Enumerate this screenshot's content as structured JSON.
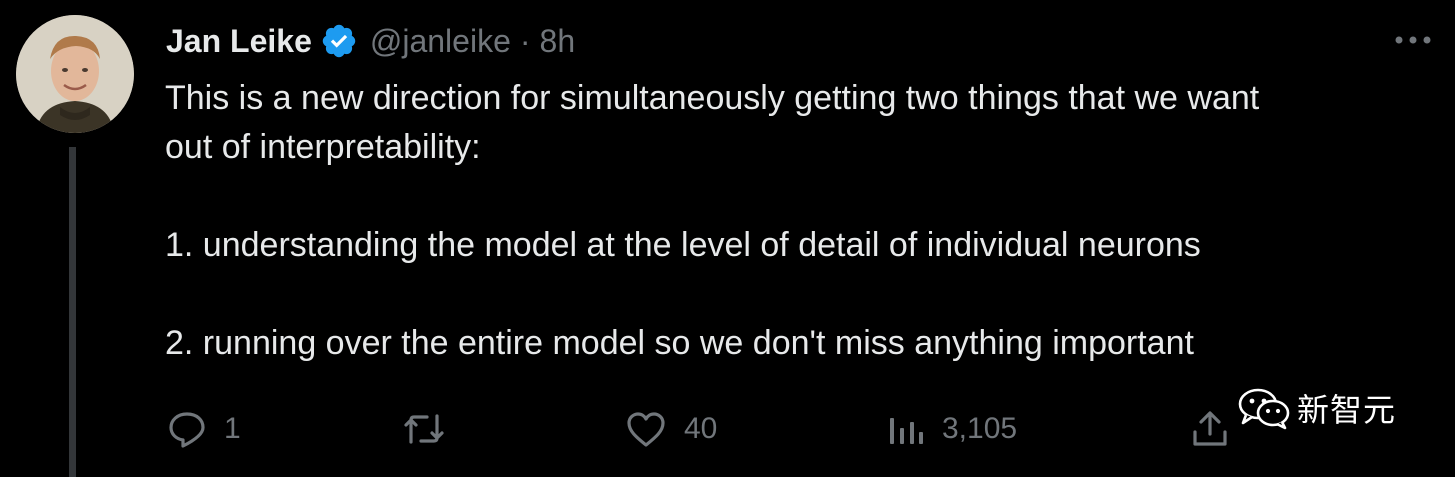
{
  "author": {
    "display_name": "Jan Leike",
    "handle": "@janleike",
    "separator": "·",
    "time": "8h",
    "verified": true,
    "avatar_icon": "profile-photo"
  },
  "tweet": {
    "lines": [
      "This is a new direction for simultaneously getting two things that we want",
      "out of interpretability:",
      "1. understanding the model at the level of detail of individual neurons",
      "2. running over the entire model so we don't miss anything important"
    ]
  },
  "actions": {
    "reply": {
      "icon": "reply-icon",
      "count": "1"
    },
    "retweet": {
      "icon": "retweet-icon",
      "count": ""
    },
    "like": {
      "icon": "heart-icon",
      "count": "40"
    },
    "views": {
      "icon": "views-icon",
      "count": "3,105"
    },
    "share": {
      "icon": "share-icon",
      "count": ""
    }
  },
  "watermark": {
    "brand": "新智元",
    "icon": "wechat-icon"
  },
  "colors": {
    "background": "#000000",
    "text": "#e7e9ea",
    "muted": "#71767b",
    "verified_blue": "#1d9bf0",
    "thread_line": "#333639"
  }
}
